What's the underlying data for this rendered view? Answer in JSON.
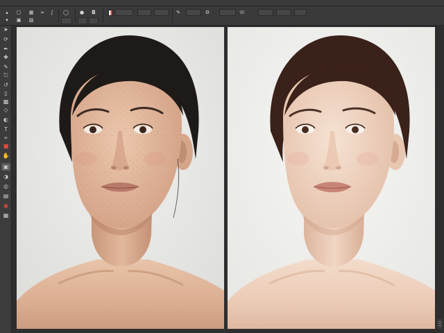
{
  "menubar": {
    "items": [
      "",
      "",
      "",
      "",
      "",
      "",
      "",
      "",
      "",
      "",
      ""
    ]
  },
  "options": {
    "buttons": [
      "",
      "",
      "",
      "",
      ""
    ]
  },
  "toolbar": {
    "tools": [
      "move-tool",
      "lasso-tool",
      "pen-tool",
      "healing-tool",
      "brush-tool",
      "clone-stamp-tool",
      "history-brush-tool",
      "eraser-tool",
      "gradient-tool",
      "blur-tool",
      "dodge-tool",
      "type-tool",
      "path-select-tool",
      "shape-tool",
      "hand-tool",
      "zoom-tool",
      "foreground-color",
      "quick-mask",
      "screen-mode"
    ]
  },
  "documents": [
    {
      "name": "before-photo",
      "subject": "original-portrait"
    },
    {
      "name": "after-photo",
      "subject": "retouched-portrait"
    }
  ],
  "colors": {
    "background": "#2e2e2e",
    "panel": "#3a3a3a",
    "accent": "#c6473b"
  }
}
